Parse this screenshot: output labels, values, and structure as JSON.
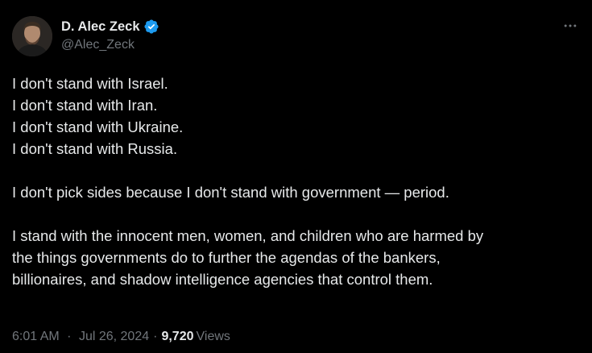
{
  "author": {
    "display_name": "D. Alec Zeck",
    "handle": "@Alec_Zeck",
    "verified": true,
    "avatar_icon": "profile-photo"
  },
  "tweet": {
    "lines": [
      "I don't stand with Israel.",
      "I don't stand with Iran.",
      "I don't stand with Ukraine.",
      "I don't stand with Russia.",
      "",
      "I don't pick sides because I don't stand with government — period.",
      "",
      "I stand with the innocent men, women, and children who are harmed by",
      "the things governments do to further the agendas of the bankers,",
      "billionaires, and shadow intelligence agencies that control them."
    ]
  },
  "meta": {
    "time": "6:01 AM",
    "separator": "·",
    "date": "Jul 26, 2024",
    "views_count": "9,720",
    "views_label": "Views"
  },
  "icons": {
    "more": "more-icon",
    "verified": "verified-badge-icon"
  },
  "colors": {
    "background": "#000000",
    "text": "#e7e9ea",
    "secondary": "#71767b",
    "verified_blue": "#1d9bf0"
  }
}
